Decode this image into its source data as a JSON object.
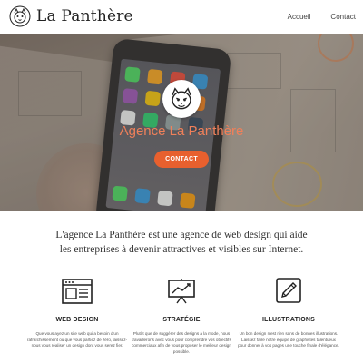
{
  "header": {
    "logo_text": "La Panthère",
    "logo_icon": "panther-icon",
    "nav": [
      {
        "label": "Accueil"
      },
      {
        "label": "Contact"
      }
    ]
  },
  "hero": {
    "badge_icon": "panther-icon",
    "title": "Agence La Panthère",
    "cta_label": "CONTACT",
    "accent": "#e8602e"
  },
  "intro": {
    "text": "L'agence La Panthère est une agence de web design qui aide les entreprises à devenir attractives et visibles sur Internet."
  },
  "features": [
    {
      "icon": "browser-window-icon",
      "title": "WEB DESIGN",
      "description": "Que vous ayez un site web qui a besoin d'un rafraîchissement ou que vous partiez de zéro, laissez-nous vous réaliser un design dont vous serez fier."
    },
    {
      "icon": "chart-board-icon",
      "title": "STRATÉGIE",
      "description": "Plutôt que de suggérer des designs à la mode, nous travaillerons avec vous pour comprendre vos objectifs commerciaux afin de vous proposer le meilleur design possible."
    },
    {
      "icon": "pencil-icon",
      "title": "ILLUSTRATIONS",
      "description": "Un bon design n'est rien sans de bonnes illustrations. Laissez faire notre équipe de graphistes talentueux pour donner à vos pages une touche finale d'élégance."
    }
  ]
}
